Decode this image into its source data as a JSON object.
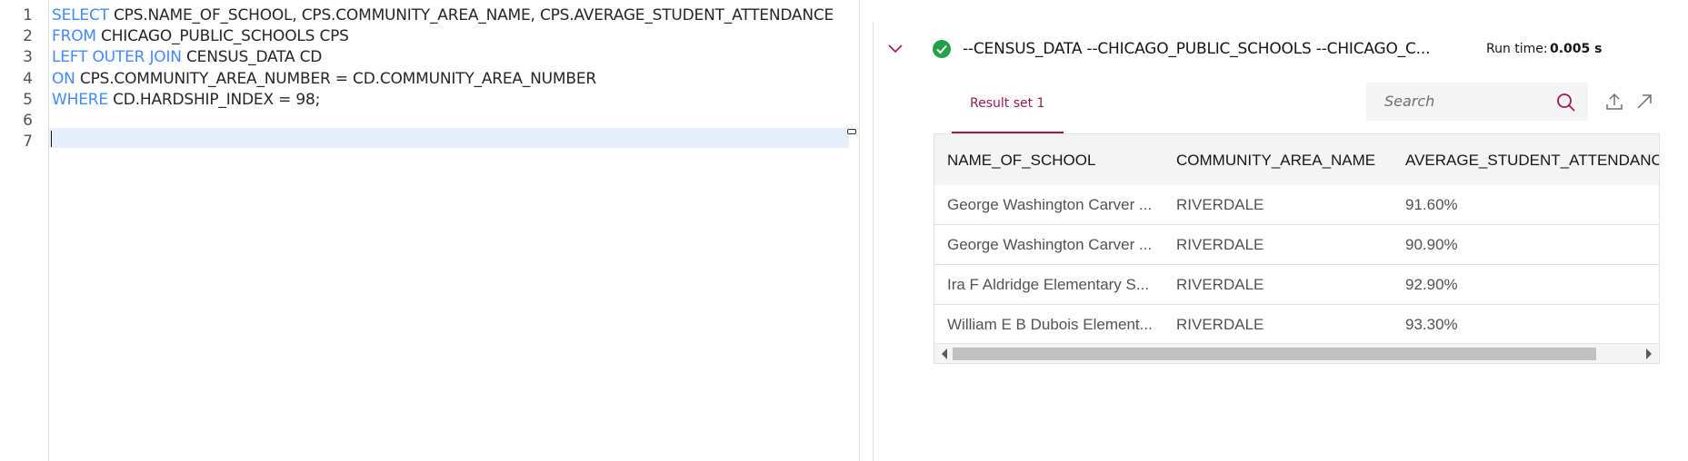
{
  "editor": {
    "line_numbers": [
      "1",
      "2",
      "3",
      "4",
      "5",
      "6",
      "7"
    ],
    "lines": [
      {
        "kw": "SELECT",
        "rest": " CPS.NAME_OF_SCHOOL, CPS.COMMUNITY_AREA_NAME, CPS.AVERAGE_STUDENT_ATTENDANCE"
      },
      {
        "kw": "FROM",
        "rest": " CHICAGO_PUBLIC_SCHOOLS CPS"
      },
      {
        "kw": "LEFT OUTER JOIN",
        "rest": " CENSUS_DATA CD"
      },
      {
        "kw": "ON",
        "rest": " CPS.COMMUNITY_AREA_NUMBER = CD.COMMUNITY_AREA_NUMBER"
      },
      {
        "kw": "WHERE",
        "rest": " CD.HARDSHIP_INDEX = 98;"
      },
      {
        "kw": "",
        "rest": ""
      },
      {
        "kw": "",
        "rest": ""
      }
    ],
    "keyword_color": "#4589ff"
  },
  "result": {
    "status": "success",
    "status_color": "#24a148",
    "query_title": "--CENSUS_DATA --CHICAGO_PUBLIC_SCHOOLS --CHICAGO_C...",
    "runtime_label": "Run time:",
    "runtime_value": "0.005 s",
    "tabs": [
      {
        "label": "Result set 1",
        "active": true
      }
    ],
    "accent_color": "#9f1853",
    "search": {
      "placeholder": "Search"
    },
    "icons": [
      "chevron-down-icon",
      "success-check-icon",
      "search-icon",
      "export-icon",
      "expand-icon"
    ],
    "table": {
      "columns": [
        "NAME_OF_SCHOOL",
        "COMMUNITY_AREA_NAME",
        "AVERAGE_STUDENT_ATTENDANCE"
      ],
      "rows": [
        [
          "George Washington Carver ...",
          "RIVERDALE",
          "91.60%"
        ],
        [
          "George Washington Carver ...",
          "RIVERDALE",
          "90.90%"
        ],
        [
          "Ira F Aldridge Elementary S...",
          "RIVERDALE",
          "92.90%"
        ],
        [
          "William E B Dubois Element...",
          "RIVERDALE",
          "93.30%"
        ]
      ]
    }
  }
}
